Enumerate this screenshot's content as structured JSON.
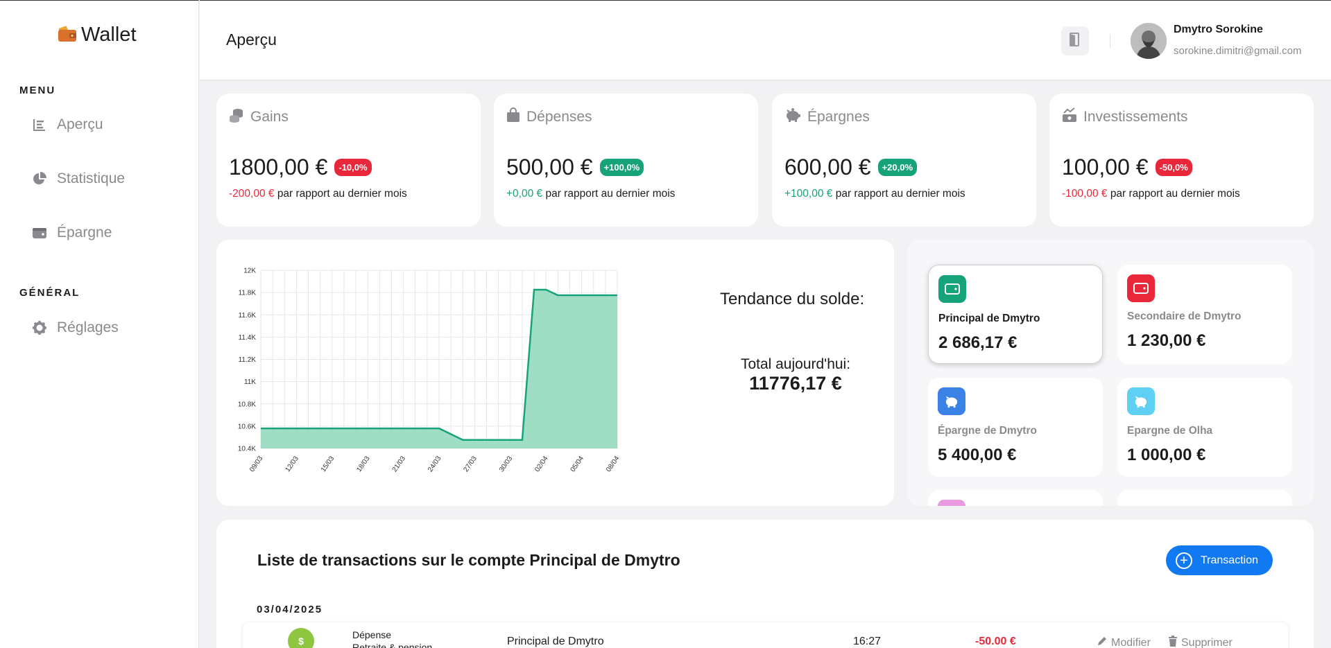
{
  "app": {
    "name": "Wallet"
  },
  "sidebar": {
    "menu_heading": "MENU",
    "general_heading": "GÉNÉRAL",
    "items": [
      {
        "label": "Aperçu",
        "icon": "chart-bar-icon"
      },
      {
        "label": "Statistique",
        "icon": "pie-chart-icon"
      },
      {
        "label": "Épargne",
        "icon": "wallet-icon"
      },
      {
        "label": "Réglages",
        "icon": "gear-icon"
      }
    ]
  },
  "header": {
    "title": "Aperçu",
    "user_name": "Dmytro Sorokine",
    "user_email": "sorokine.dimitri@gmail.com"
  },
  "stats": [
    {
      "label": "Gains",
      "icon": "coins-icon",
      "amount": "1800,00 €",
      "badge": "-10,0%",
      "trend": "down",
      "delta": "-200,00 €",
      "suffix": "par rapport au dernier mois"
    },
    {
      "label": "Dépenses",
      "icon": "shopping-bag-icon",
      "amount": "500,00 €",
      "badge": "+100,0%",
      "trend": "up",
      "delta": "+0,00 €",
      "suffix": "par rapport au dernier mois"
    },
    {
      "label": "Épargnes",
      "icon": "piggy-bank-icon",
      "amount": "600,00 €",
      "badge": "+20,0%",
      "trend": "up",
      "delta": "+100,00 €",
      "suffix": "par rapport au dernier mois"
    },
    {
      "label": "Investissements",
      "icon": "investment-icon",
      "amount": "100,00 €",
      "badge": "-50,0%",
      "trend": "down",
      "delta": "-100,00 €",
      "suffix": "par rapport au dernier mois"
    }
  ],
  "trend": {
    "title": "Tendance du solde:",
    "total_label": "Total aujourd'hui:",
    "total_value": "11776,17 €"
  },
  "chart_data": {
    "type": "area",
    "x": [
      "09/03",
      "12/03",
      "15/03",
      "18/03",
      "21/03",
      "24/03",
      "27/03",
      "30/03",
      "02/04",
      "05/04",
      "08/04"
    ],
    "y_ticks": [
      "12K",
      "11.8K",
      "11.6K",
      "11.4K",
      "11.2K",
      "11K",
      "10.8K",
      "10.6K",
      "10.4K"
    ],
    "ylim": [
      10400,
      12000
    ],
    "points": [
      {
        "x": 0,
        "y": 10580
      },
      {
        "x": 15,
        "y": 10580
      },
      {
        "x": 17,
        "y": 10476
      },
      {
        "x": 22,
        "y": 10476
      },
      {
        "x": 23,
        "y": 11826
      },
      {
        "x": 24,
        "y": 11826
      },
      {
        "x": 25,
        "y": 11776
      },
      {
        "x": 30,
        "y": 11776
      }
    ],
    "color": "#17a37a",
    "fill": "#8ed8bb",
    "grid": true
  },
  "accounts": [
    {
      "name": "Principal de Dmytro",
      "balance": "2 686,17 €",
      "icon": "wallet-icon",
      "color": "#17a37a",
      "selected": true
    },
    {
      "name": "Secondaire de Dmytro",
      "balance": "1 230,00 €",
      "icon": "wallet-icon",
      "color": "#e8283a",
      "selected": false
    },
    {
      "name": "Épargne de Dmytro",
      "balance": "5 400,00 €",
      "icon": "piggy-bank-icon",
      "color": "#3b82e6",
      "selected": false
    },
    {
      "name": "Epargne de Olha",
      "balance": "1 000,00 €",
      "icon": "piggy-bank-icon",
      "color": "#5fd0f3",
      "selected": false
    }
  ],
  "transactions": {
    "title": "Liste de transactions sur le compte Principal de Dmytro",
    "add_label": "Transaction",
    "date": "03/04/2025",
    "rows": [
      {
        "type": "Dépense",
        "category": "Retraite & pension",
        "account": "Principal de Dmytro",
        "time": "16:27",
        "amount": "-50.00 €",
        "edit": "Modifier",
        "delete": "Supprimer"
      }
    ]
  }
}
